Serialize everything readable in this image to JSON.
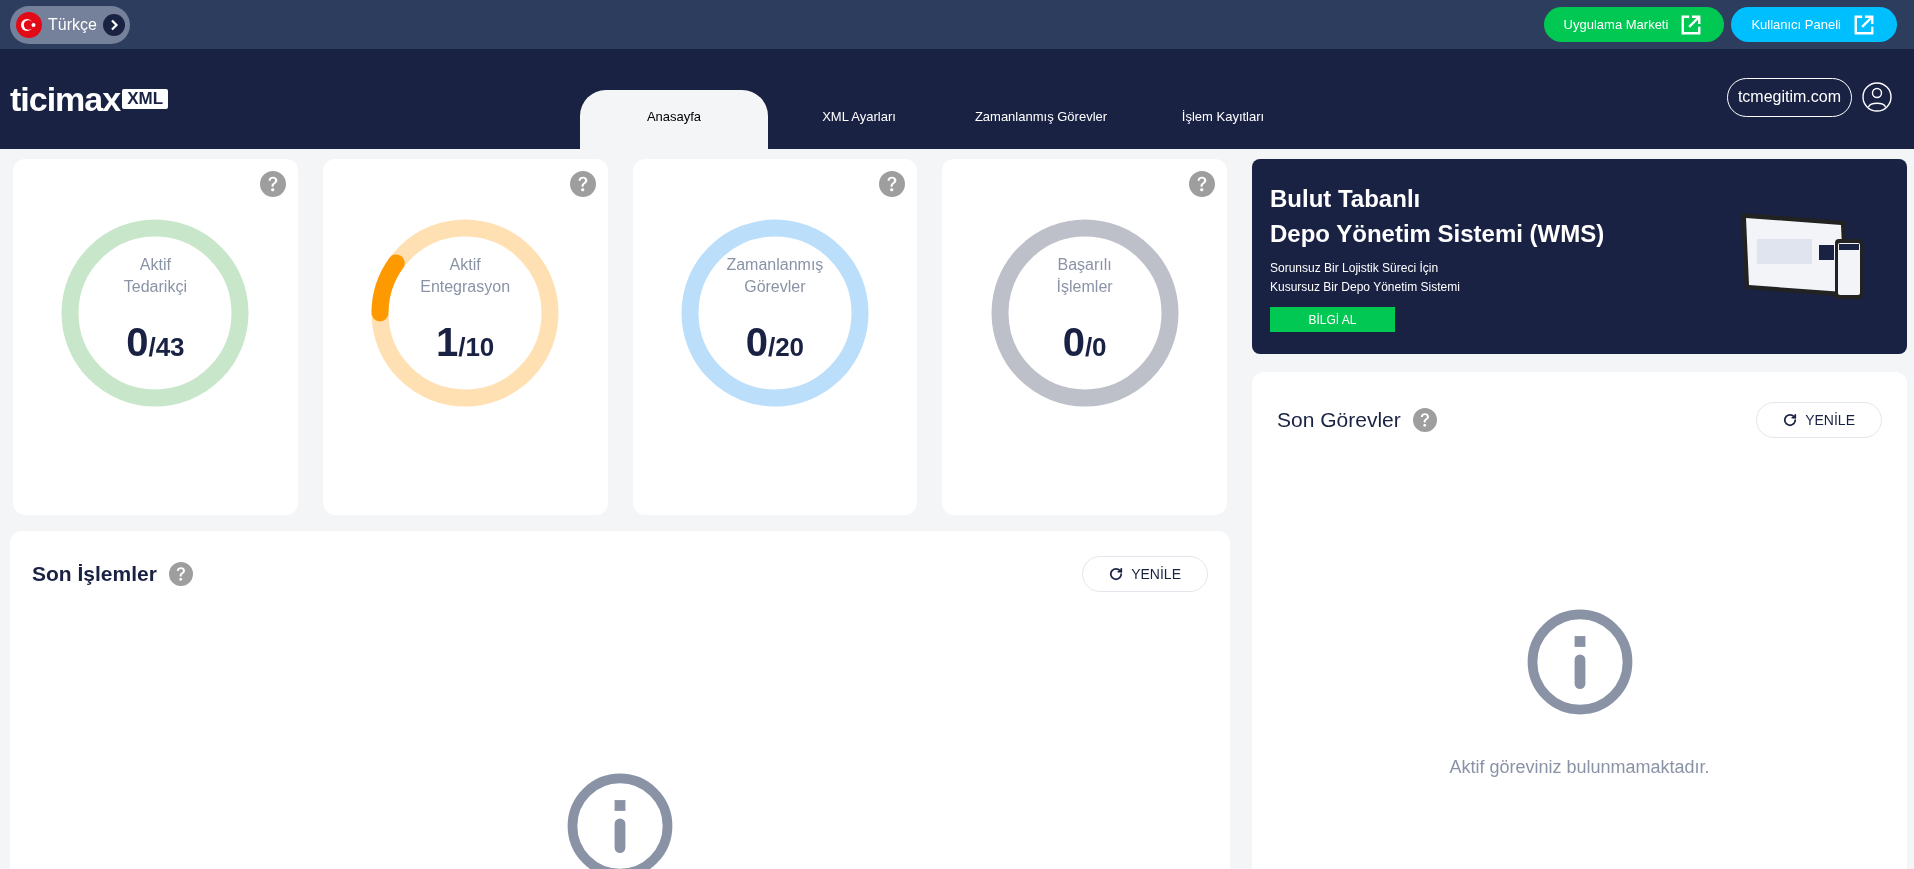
{
  "top_bar": {
    "language": "Türkçe",
    "buttons": [
      {
        "label": "Uygulama Marketi",
        "color": "#00c853"
      },
      {
        "label": "Kullanıcı Paneli",
        "color": "#00bfff"
      }
    ]
  },
  "header": {
    "logo": {
      "name": "ticimax",
      "badge": "XML"
    },
    "tabs": [
      {
        "label": "Anasayfa",
        "selected": true
      },
      {
        "label": "XML Ayarları",
        "selected": false
      },
      {
        "label": "Zamanlanmış Görevler",
        "selected": false
      },
      {
        "label": "İşlem Kayıtları",
        "selected": false
      }
    ],
    "account": "tcmegitim.com"
  },
  "gauges": [
    {
      "label_lines": [
        "Aktif",
        "Tedarikçi"
      ],
      "value": "0",
      "total": "/43",
      "color": "#c8e6c9"
    },
    {
      "label_lines": [
        "Aktif",
        "Entegrasyon"
      ],
      "value": "1",
      "total": "/10",
      "color": "#ffe0b2"
    },
    {
      "label_lines": [
        "Zamanlanmış",
        "Görevler"
      ],
      "value": "0",
      "total": "/20",
      "color": "#bbdefb"
    },
    {
      "label_lines": [
        "Başarılı",
        "İşlemler"
      ],
      "value": "0",
      "total": "/0",
      "color": "#bdc0c9"
    }
  ],
  "recent_operations": {
    "title": "Son İşlemler",
    "refresh": "YENİLE"
  },
  "banner": {
    "title_lines": [
      "Bulut Tabanlı",
      "Depo Yönetim Sistemi (WMS)"
    ],
    "subtitle_lines": [
      "Sorunsuz Bir Lojistik Süreci İçin",
      "Kusursuz Bir Depo Yönetim Sistemi"
    ],
    "button": "BİLGİ AL"
  },
  "recent_tasks": {
    "title": "Son Görevler",
    "refresh": "YENİLE",
    "empty_message": "Aktif göreviniz bulunmamaktadır."
  }
}
